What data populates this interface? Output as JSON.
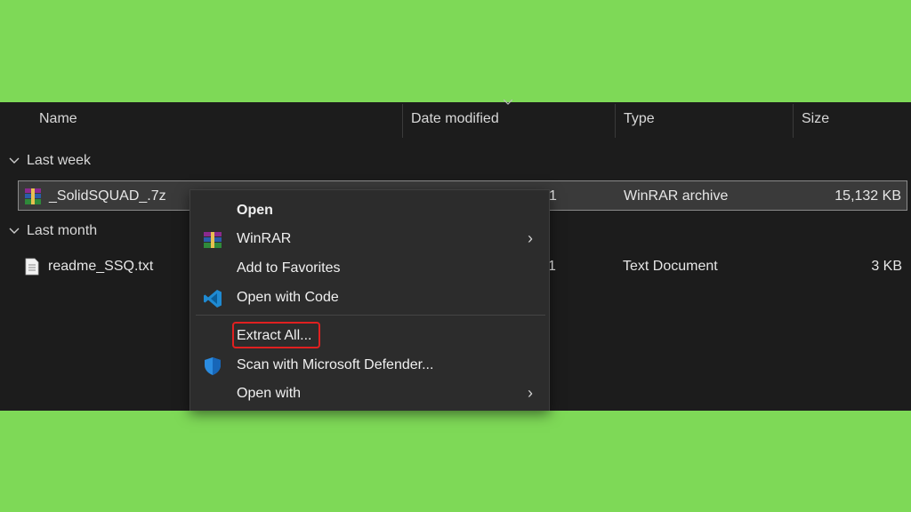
{
  "columns": {
    "name": "Name",
    "date_modified": "Date modified",
    "type": "Type",
    "size": "Size"
  },
  "groups": [
    {
      "label": "Last week"
    },
    {
      "label": "Last month"
    }
  ],
  "files": [
    {
      "name": "_SolidSQUAD_.7z",
      "date_fragment": "1",
      "type": "WinRAR archive",
      "size": "15,132 KB",
      "icon": "winrar-icon"
    },
    {
      "name": "readme_SSQ.txt",
      "date_fragment": "1",
      "type": "Text Document",
      "size": "3 KB",
      "icon": "text-file-icon"
    }
  ],
  "context_menu": {
    "items": [
      {
        "label": "Open",
        "icon": null,
        "submenu": false
      },
      {
        "label": "WinRAR",
        "icon": "winrar-icon",
        "submenu": true
      },
      {
        "label": "Add to Favorites",
        "icon": null,
        "submenu": false
      },
      {
        "label": "Open with Code",
        "icon": "vscode-icon",
        "submenu": false
      },
      {
        "label": "Extract All...",
        "icon": null,
        "submenu": false,
        "highlighted": true
      },
      {
        "label": "Scan with Microsoft Defender...",
        "icon": "defender-shield-icon",
        "submenu": false
      },
      {
        "label": "Open with",
        "icon": null,
        "submenu": true
      }
    ]
  },
  "colors": {
    "background": "#7ed957",
    "explorer_bg": "#1c1c1c",
    "menu_bg": "#2c2c2c",
    "highlight": "#e02020"
  }
}
